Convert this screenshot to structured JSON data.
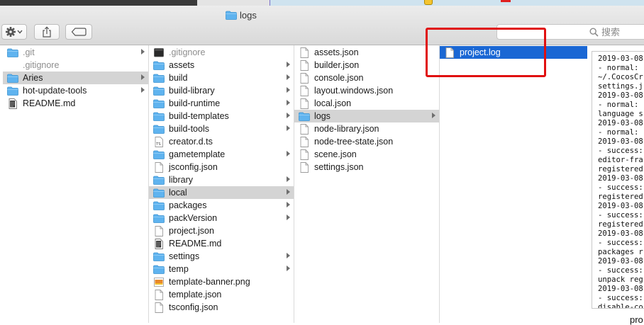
{
  "window": {
    "title": "logs"
  },
  "toolbar": {
    "search_placeholder": "搜索"
  },
  "columns": [
    {
      "items": [
        {
          "label": ".git",
          "icon": "folder-icon",
          "dim": true,
          "chevron": true,
          "state": ""
        },
        {
          "label": ".gitignore",
          "icon": "none",
          "dim": true,
          "chevron": false,
          "state": ""
        },
        {
          "label": "Aries",
          "icon": "folder-icon",
          "dim": false,
          "chevron": true,
          "state": "gray"
        },
        {
          "label": "hot-update-tools",
          "icon": "folder-icon",
          "dim": false,
          "chevron": true,
          "state": ""
        },
        {
          "label": "README.md",
          "icon": "text-doc-icon",
          "dim": false,
          "chevron": false,
          "state": ""
        }
      ]
    },
    {
      "items": [
        {
          "label": ".gitignore",
          "icon": "black-doc-icon",
          "dim": true,
          "chevron": false,
          "state": ""
        },
        {
          "label": "assets",
          "icon": "folder-icon",
          "dim": false,
          "chevron": true,
          "state": ""
        },
        {
          "label": "build",
          "icon": "folder-icon",
          "dim": false,
          "chevron": true,
          "state": ""
        },
        {
          "label": "build-library",
          "icon": "folder-icon",
          "dim": false,
          "chevron": true,
          "state": ""
        },
        {
          "label": "build-runtime",
          "icon": "folder-icon",
          "dim": false,
          "chevron": true,
          "state": ""
        },
        {
          "label": "build-templates",
          "icon": "folder-icon",
          "dim": false,
          "chevron": true,
          "state": ""
        },
        {
          "label": "build-tools",
          "icon": "folder-icon",
          "dim": false,
          "chevron": true,
          "state": ""
        },
        {
          "label": "creator.d.ts",
          "icon": "ts-file-icon",
          "dim": false,
          "chevron": false,
          "state": ""
        },
        {
          "label": "gametemplate",
          "icon": "folder-icon",
          "dim": false,
          "chevron": true,
          "state": ""
        },
        {
          "label": "jsconfig.json",
          "icon": "file-icon",
          "dim": false,
          "chevron": false,
          "state": ""
        },
        {
          "label": "library",
          "icon": "folder-icon",
          "dim": false,
          "chevron": true,
          "state": ""
        },
        {
          "label": "local",
          "icon": "folder-icon",
          "dim": false,
          "chevron": true,
          "state": "gray"
        },
        {
          "label": "packages",
          "icon": "folder-icon",
          "dim": false,
          "chevron": true,
          "state": ""
        },
        {
          "label": "packVersion",
          "icon": "folder-icon",
          "dim": false,
          "chevron": true,
          "state": ""
        },
        {
          "label": "project.json",
          "icon": "file-icon",
          "dim": false,
          "chevron": false,
          "state": ""
        },
        {
          "label": "README.md",
          "icon": "text-doc-icon",
          "dim": false,
          "chevron": false,
          "state": ""
        },
        {
          "label": "settings",
          "icon": "folder-icon",
          "dim": false,
          "chevron": true,
          "state": ""
        },
        {
          "label": "temp",
          "icon": "folder-icon",
          "dim": false,
          "chevron": true,
          "state": ""
        },
        {
          "label": "template-banner.png",
          "icon": "image-file-icon",
          "dim": false,
          "chevron": false,
          "state": ""
        },
        {
          "label": "template.json",
          "icon": "file-icon",
          "dim": false,
          "chevron": false,
          "state": ""
        },
        {
          "label": "tsconfig.json",
          "icon": "file-icon",
          "dim": false,
          "chevron": false,
          "state": ""
        }
      ]
    },
    {
      "items": [
        {
          "label": "assets.json",
          "icon": "file-icon",
          "dim": false,
          "chevron": false,
          "state": ""
        },
        {
          "label": "builder.json",
          "icon": "file-icon",
          "dim": false,
          "chevron": false,
          "state": ""
        },
        {
          "label": "console.json",
          "icon": "file-icon",
          "dim": false,
          "chevron": false,
          "state": ""
        },
        {
          "label": "layout.windows.json",
          "icon": "file-icon",
          "dim": false,
          "chevron": false,
          "state": ""
        },
        {
          "label": "local.json",
          "icon": "file-icon",
          "dim": false,
          "chevron": false,
          "state": ""
        },
        {
          "label": "logs",
          "icon": "folder-icon",
          "dim": false,
          "chevron": true,
          "state": "gray"
        },
        {
          "label": "node-library.json",
          "icon": "file-icon",
          "dim": false,
          "chevron": false,
          "state": ""
        },
        {
          "label": "node-tree-state.json",
          "icon": "file-icon",
          "dim": false,
          "chevron": false,
          "state": ""
        },
        {
          "label": "scene.json",
          "icon": "file-icon",
          "dim": false,
          "chevron": false,
          "state": ""
        },
        {
          "label": "settings.json",
          "icon": "file-icon",
          "dim": false,
          "chevron": false,
          "state": ""
        }
      ]
    },
    {
      "items": [
        {
          "label": "project.log",
          "icon": "file-icon",
          "dim": false,
          "chevron": false,
          "state": "blue"
        }
      ]
    }
  ],
  "preview": {
    "lines": [
      "2019-03-08",
      "- normal:",
      "~/.CocosCr",
      "settings.j",
      "2019-03-08",
      "- normal:",
      "language s",
      "2019-03-08",
      "- normal:",
      "2019-03-08",
      "- success:",
      "editor-fra",
      "registered",
      "2019-03-08",
      "- success:",
      "registered",
      "2019-03-08",
      "- success:",
      "registered",
      "2019-03-08",
      "- success:",
      "packages r",
      "2019-03-08",
      "- success:",
      "unpack reg",
      "2019-03-08",
      "- success:",
      "disable-co"
    ],
    "bottom_cut_text": "pro"
  },
  "colors": {
    "selection_blue": "#1a67d4",
    "selection_gray": "#d4d4d4",
    "folder_blue": "#5fb3ef",
    "annotation_red": "#e01010"
  }
}
